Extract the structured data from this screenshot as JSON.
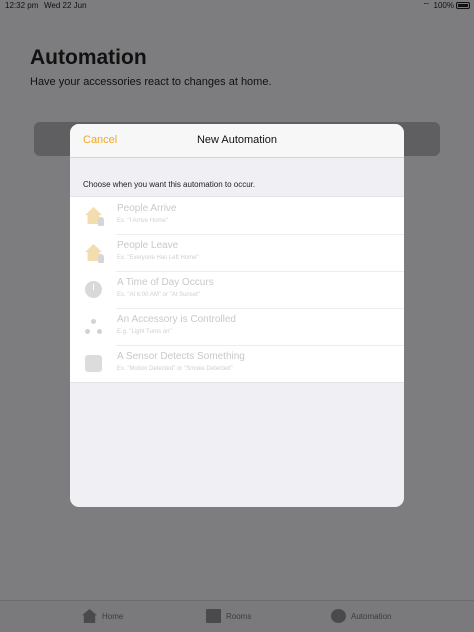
{
  "status_bar": {
    "time": "12:32 pm",
    "date": "Wed 22 Jun",
    "battery": "100%"
  },
  "background": {
    "title": "Automation",
    "subtitle": "Have your accessories react to changes at home."
  },
  "modal": {
    "cancel_label": "Cancel",
    "title": "New Automation",
    "section_label": "Choose when you want this automation to occur.",
    "options": [
      {
        "title": "People Arrive",
        "subtitle": "Ex. \"I Arrive Home\"",
        "icon": "house-arrive-icon"
      },
      {
        "title": "People Leave",
        "subtitle": "Ex. \"Everyone Has Left Home\"",
        "icon": "house-leave-icon"
      },
      {
        "title": "A Time of Day Occurs",
        "subtitle": "Ex. \"At 6:00 AM\" or \"At Sunset\"",
        "icon": "clock-icon"
      },
      {
        "title": "An Accessory is Controlled",
        "subtitle": "E.g. \"Light Turns on\"",
        "icon": "accessory-icon"
      },
      {
        "title": "A Sensor Detects Something",
        "subtitle": "Ex. \"Motion Detected\" or \"Smoke Detected\"",
        "icon": "sensor-icon"
      }
    ]
  },
  "tab_bar": {
    "tabs": [
      {
        "label": "Home",
        "icon": "house-icon"
      },
      {
        "label": "Rooms",
        "icon": "rooms-icon"
      },
      {
        "label": "Automation",
        "icon": "automation-icon"
      }
    ]
  },
  "colors": {
    "accent": "#f5a623",
    "dimmed_background": "#7d7d7f",
    "sheet": "#efeff4"
  }
}
